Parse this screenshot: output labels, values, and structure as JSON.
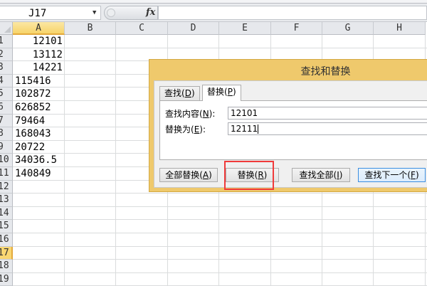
{
  "formula_bar": {
    "name_box": "J17",
    "fx_label": "fx",
    "formula": ""
  },
  "columns": [
    "A",
    "B",
    "C",
    "D",
    "E",
    "F",
    "G",
    "H"
  ],
  "selected_column": "A",
  "rows": [
    "1",
    "2",
    "3",
    "4",
    "5",
    "6",
    "7",
    "8",
    "9",
    "10",
    "11",
    "12",
    "13",
    "14",
    "15",
    "16",
    "17",
    "18",
    "19"
  ],
  "selected_row": "17",
  "cells_A": [
    "12101",
    "13112",
    "14221",
    "115416",
    "102872",
    "626852",
    "79464",
    "168043",
    "20722",
    "34036.5",
    "140849"
  ],
  "dialog": {
    "title": "查找和替换",
    "tabs": [
      {
        "label": "查找(",
        "key": "D",
        "end": ")"
      },
      {
        "label": "替换(",
        "key": "P",
        "end": ")"
      }
    ],
    "find_label": "查找内容(",
    "find_key": "N",
    "find_end": "):",
    "find_value": "12101",
    "replace_label": "替换为(",
    "replace_key": "E",
    "replace_end": "):",
    "replace_value": "12111",
    "buttons": [
      {
        "label": "全部替换(",
        "key": "A",
        "end": ")"
      },
      {
        "label": "替换(",
        "key": "R",
        "end": ")"
      },
      {
        "label": "查找全部(",
        "key": "I",
        "end": ")"
      },
      {
        "label": "查找下一个(",
        "key": "F",
        "end": ")"
      }
    ]
  },
  "colors": {
    "dialog_frame": "#efc96c",
    "highlight": "#f03a3a",
    "selected_header": "#f9d772"
  }
}
